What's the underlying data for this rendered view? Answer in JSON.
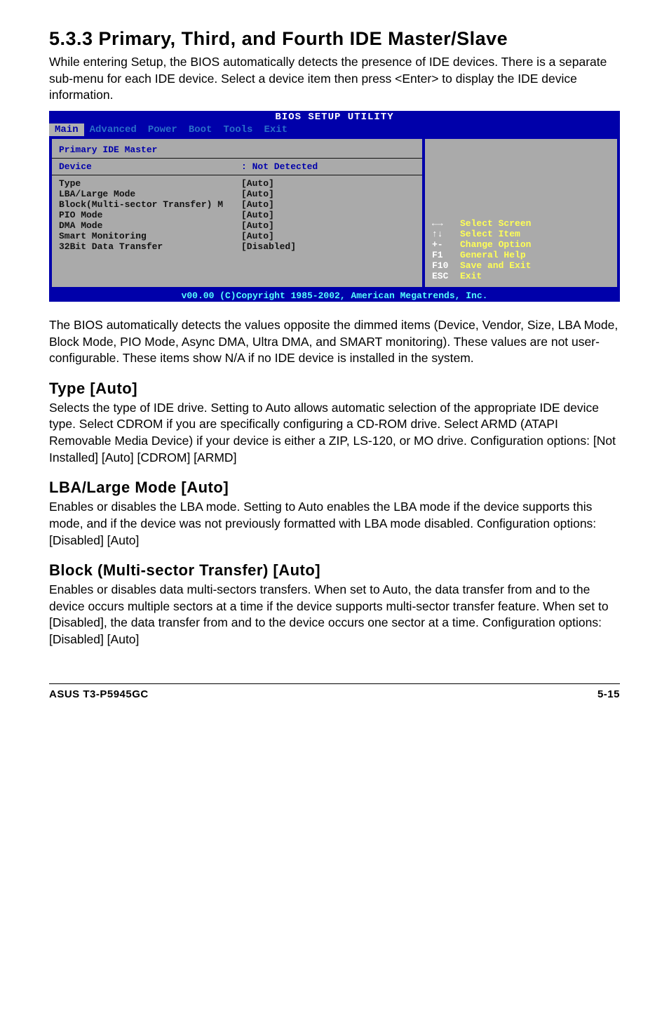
{
  "section": {
    "title": "5.3.3   Primary, Third, and Fourth IDE Master/Slave",
    "intro": "While entering Setup, the BIOS automatically detects the presence of IDE devices. There is a separate sub-menu for each IDE device. Select a device item then press <Enter> to display the IDE device information.",
    "after_bios": "The BIOS automatically detects the values opposite the dimmed items (Device, Vendor, Size, LBA Mode, Block Mode, PIO Mode, Async DMA, Ultra DMA, and SMART monitoring). These values are not user-configurable. These items show N/A if no IDE device is installed in the system."
  },
  "bios": {
    "title": "BIOS SETUP UTILITY",
    "tabs": [
      "Main",
      "Advanced",
      "Power",
      "Boot",
      "Tools",
      "Exit"
    ],
    "active_tab": 0,
    "panel_title": "Primary IDE Master",
    "device_label": "Device",
    "device_value": ": Not Detected",
    "rows": [
      {
        "label": "Type",
        "value": "[Auto]"
      },
      {
        "label": "LBA/Large Mode",
        "value": "[Auto]"
      },
      {
        "label": "Block(Multi-sector Transfer) M",
        "value": "[Auto]"
      },
      {
        "label": "PIO Mode",
        "value": "[Auto]"
      },
      {
        "label": "DMA Mode",
        "value": "[Auto]"
      },
      {
        "label": "Smart Monitoring",
        "value": "[Auto]"
      },
      {
        "label": "32Bit Data Transfer",
        "value": "[Disabled]"
      }
    ],
    "help": [
      {
        "key": "←→",
        "text": "Select Screen"
      },
      {
        "key": "↑↓",
        "text": "Select Item"
      },
      {
        "key": "+-",
        "text": "Change Option"
      },
      {
        "key": "F1",
        "text": "General Help"
      },
      {
        "key": "F10",
        "text": "Save and Exit"
      },
      {
        "key": "ESC",
        "text": "Exit"
      }
    ],
    "footer": "v00.00 (C)Copyright 1985-2002, American Megatrends, Inc."
  },
  "subsections": {
    "type": {
      "title": "Type [Auto]",
      "body": "Selects the type of IDE drive. Setting to Auto allows automatic selection of the appropriate IDE device type. Select CDROM if you are specifically configuring a CD-ROM drive. Select ARMD (ATAPI Removable Media Device) if your device is either a ZIP, LS-120, or MO drive. Configuration options: [Not Installed] [Auto] [CDROM] [ARMD]"
    },
    "lba": {
      "title": "LBA/Large Mode [Auto]",
      "body": "Enables or disables the LBA mode. Setting to Auto enables the LBA mode if the device supports this mode, and if the device was not previously formatted with LBA mode disabled. Configuration options: [Disabled] [Auto]"
    },
    "block": {
      "title": "Block (Multi-sector Transfer) [Auto]",
      "body": "Enables or disables data multi-sectors transfers. When set to Auto, the data transfer from and to the device occurs multiple sectors at a time if the device supports multi-sector transfer feature. When set to [Disabled], the data transfer from and to the device occurs one sector at a time. Configuration options: [Disabled] [Auto]"
    }
  },
  "footer": {
    "left": "ASUS T3-P5945GC",
    "right": "5-15"
  }
}
